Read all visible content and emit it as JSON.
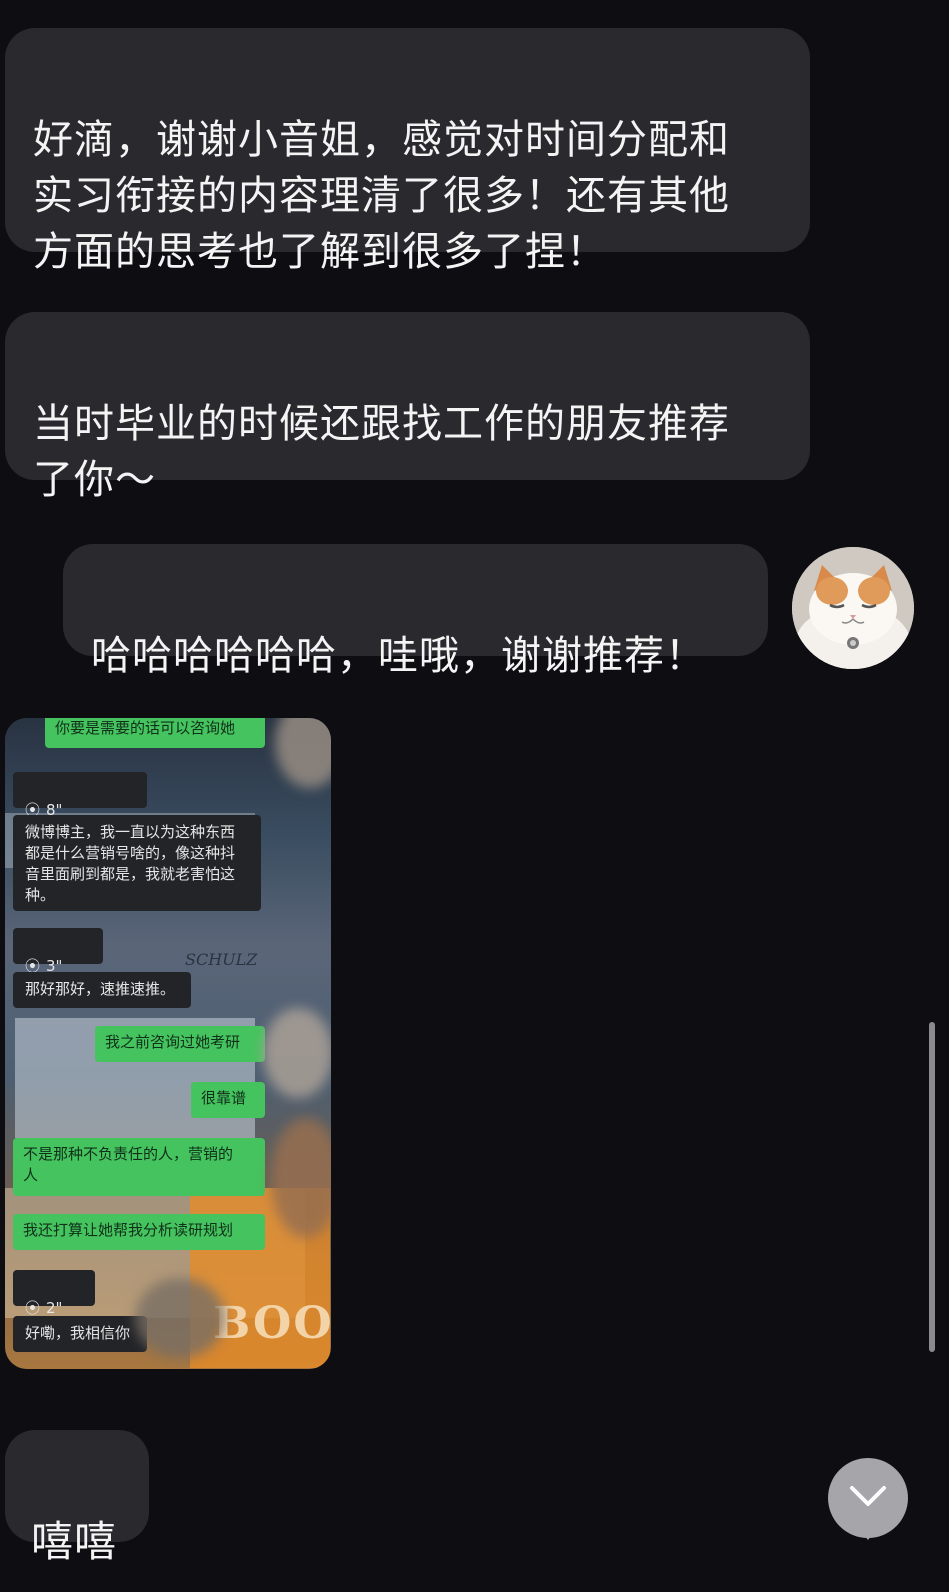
{
  "messages": {
    "msg1": "好滴，谢谢小音姐，感觉对时间分配和\n实习衔接的内容理清了很多！还有其他\n方面的思考也了解到很多了捏！",
    "msg2": "当时毕业的时候还跟找工作的朋友推荐\n了你～",
    "msg3": "哈哈哈哈哈哈，哇哦，谢谢推荐！",
    "msg5": "嘻嘻"
  },
  "image_msg": {
    "bubbles": [
      {
        "side": "right",
        "text": "你要是需要的话可以咨询她"
      },
      {
        "side": "left",
        "voice": true,
        "text": "8\""
      },
      {
        "side": "left",
        "text": "微博博主，我一直以为这种东西\n都是什么营销号啥的，像这种抖\n音里面刷到都是，我就老害怕这\n种。"
      },
      {
        "side": "left",
        "voice": true,
        "text": "3\""
      },
      {
        "side": "left",
        "text": "那好那好，速推速推。"
      },
      {
        "side": "right",
        "text": "我之前咨询过她考研"
      },
      {
        "side": "right",
        "text": "很靠谱"
      },
      {
        "side": "right",
        "text": "不是那种不负责任的人，营销的\n人"
      },
      {
        "side": "right",
        "text": "我还打算让她帮我分析读研规划"
      },
      {
        "side": "left",
        "voice": true,
        "text": "2\""
      },
      {
        "side": "left",
        "text": "好嘞，我相信你"
      }
    ],
    "bg_text": {
      "schulz": "SCHULZ",
      "boo": "BOO"
    }
  },
  "icons": {
    "voice": "voice-wave-icon",
    "scroll": "chevron-down-icon"
  },
  "colors": {
    "background": "#0d0d12",
    "bubble": "#2a2a2e",
    "green_bubble": "#45c35e"
  }
}
